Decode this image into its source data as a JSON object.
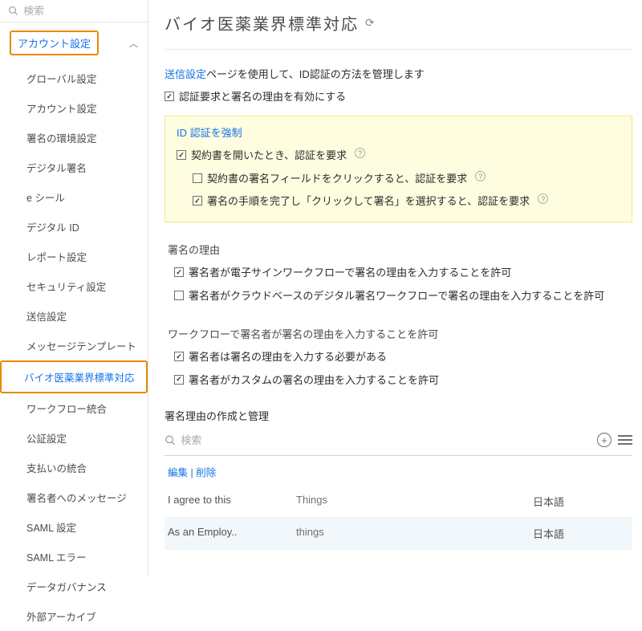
{
  "search_placeholder": "検索",
  "sidebar": {
    "section_label": "アカウント設定",
    "items": [
      "グローバル設定",
      "アカウント設定",
      "署名の環境設定",
      "デジタル署名",
      "e シール",
      "デジタル ID",
      "レポート設定",
      "セキュリティ設定",
      "送信設定",
      "メッセージテンプレート",
      "バイオ医薬業界標準対応",
      "ワークフロー統合",
      "公証設定",
      "支払いの統合",
      "署名者へのメッセージ",
      "SAML 設定",
      "SAML エラー",
      "データガバナンス",
      "外部アーカイブ"
    ],
    "active_index": 10
  },
  "page_title": "バイオ医薬業界標準対応",
  "intro": {
    "link_text": "送信設定",
    "rest_text": "ページを使用して、ID認証の方法を管理します"
  },
  "enable_reason_checkbox": "認証要求と署名の理由を有効にする",
  "enforce_box": {
    "title": "ID 認証を強制",
    "open_doc": {
      "checked": true,
      "label": "契約書を開いたとき、認証を要求"
    },
    "click_field": {
      "checked": false,
      "label": "契約書の署名フィールドをクリックすると、認証を要求"
    },
    "click_to_sign": {
      "checked": true,
      "label": "署名の手順を完了し「クリックして署名」を選択すると、認証を要求"
    }
  },
  "sign_reason": {
    "heading": "署名の理由",
    "esign_flow": {
      "checked": true,
      "label": "署名者が電子サインワークフローで署名の理由を入力することを許可"
    },
    "cloud_flow": {
      "checked": false,
      "label": "署名者がクラウドベースのデジタル署名ワークフローで署名の理由を入力することを許可"
    }
  },
  "workflow_reason": {
    "heading": "ワークフローで署名者が署名の理由を入力することを許可",
    "required": {
      "checked": true,
      "label": "署名者は署名の理由を入力する必要がある"
    },
    "custom": {
      "checked": true,
      "label": "署名者がカスタムの署名の理由を入力することを許可"
    }
  },
  "manage": {
    "title": "署名理由の作成と管理",
    "search_placeholder": "検索",
    "edit_label": "編集",
    "delete_label": "削除",
    "rows": [
      {
        "text": "I agree to this",
        "cat": "Things",
        "lang": "日本語"
      },
      {
        "text": "As an Employ..",
        "cat": "things",
        "lang": "日本語"
      }
    ]
  }
}
